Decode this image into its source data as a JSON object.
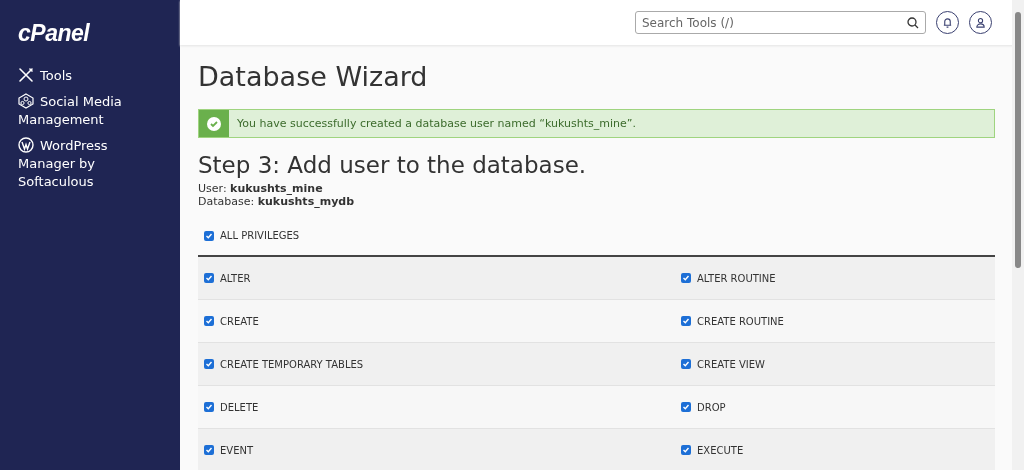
{
  "sidebar": {
    "logo": "cPanel",
    "items": [
      {
        "label": "Tools",
        "kind": "tools",
        "selected": false
      },
      {
        "label": "Social Media Management",
        "kind": "social",
        "selected": false
      },
      {
        "label": "WordPress Manager by Softaculous",
        "kind": "wordpress",
        "selected": false
      }
    ]
  },
  "header": {
    "search": {
      "placeholder": "Search Tools (/)"
    }
  },
  "page": {
    "title": "Database Wizard",
    "alert": {
      "kind": "success",
      "text": "You have successfully created a database user named “kukushts_mine”."
    },
    "step_title": "Step 3: Add user to the database.",
    "details": [
      {
        "label": "User:",
        "value": "kukushts_mine"
      },
      {
        "label": "Database:",
        "value": "kukushts_mydb"
      }
    ],
    "all_privileges": {
      "label": "ALL PRIVILEGES",
      "checked": true
    },
    "privileges": [
      {
        "label": "ALTER",
        "checked": true
      },
      {
        "label": "ALTER ROUTINE",
        "checked": true
      },
      {
        "label": "CREATE",
        "checked": true
      },
      {
        "label": "CREATE ROUTINE",
        "checked": true
      },
      {
        "label": "CREATE TEMPORARY TABLES",
        "checked": true
      },
      {
        "label": "CREATE VIEW",
        "checked": true
      },
      {
        "label": "DELETE",
        "checked": true
      },
      {
        "label": "DROP",
        "checked": true
      },
      {
        "label": "EVENT",
        "checked": true
      },
      {
        "label": "EXECUTE",
        "checked": true
      }
    ]
  }
}
